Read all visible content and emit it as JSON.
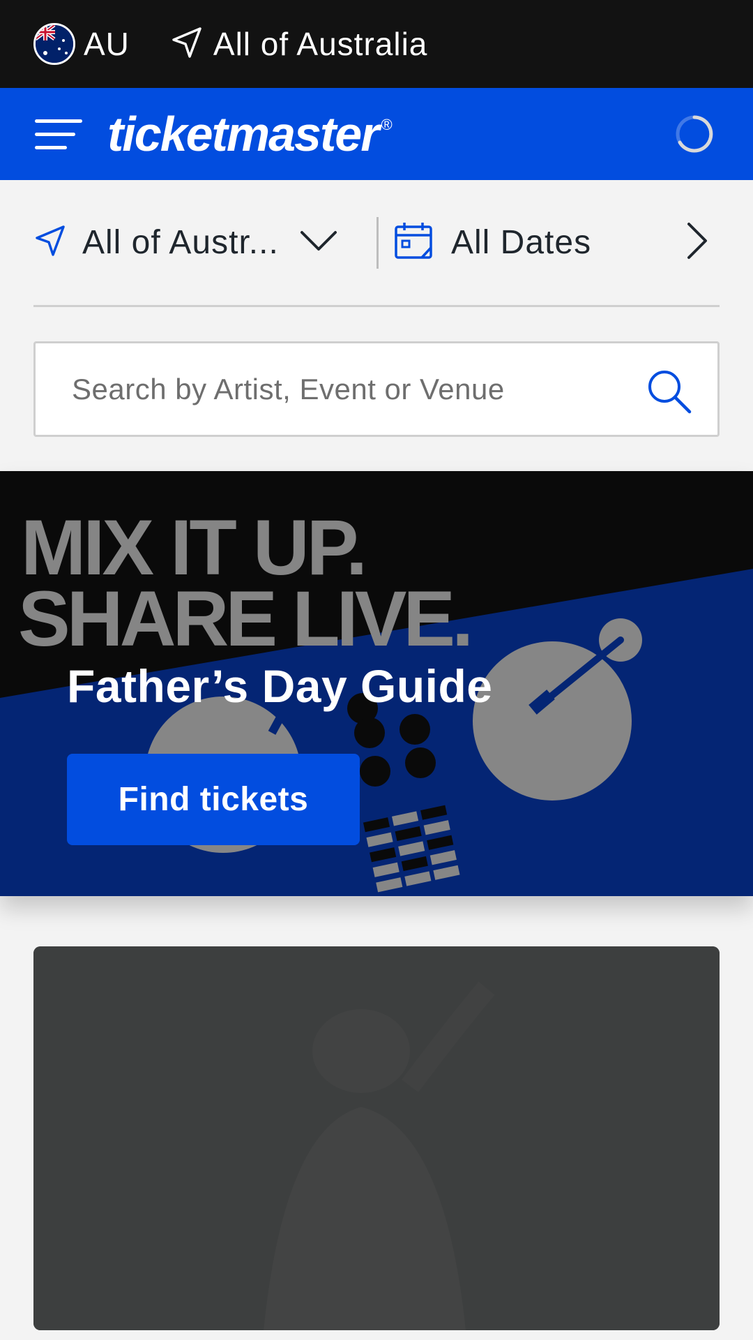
{
  "locale_bar": {
    "country_code": "AU",
    "location_label": "All of Australia"
  },
  "header": {
    "logo_text": "ticketmaster",
    "logo_mark": "®"
  },
  "filters": {
    "location_label": "All of Austr...",
    "dates_label": "All Dates"
  },
  "search": {
    "placeholder": "Search by Artist, Event or Venue",
    "value": ""
  },
  "hero": {
    "background_line_1": "MIX IT UP.",
    "background_line_2": "SHARE LIVE.",
    "title": "Father’s Day Guide",
    "cta_label": "Find tickets"
  },
  "colors": {
    "brand_blue": "#024ddf",
    "top_bar": "#121212",
    "hero_navy": "#042574",
    "text_dark": "#1f262d"
  },
  "icons": [
    "au-flag-icon",
    "location-arrow-icon",
    "hamburger-menu-icon",
    "loading-spinner-icon",
    "chevron-down-icon",
    "calendar-icon",
    "chevron-right-icon",
    "search-icon"
  ]
}
